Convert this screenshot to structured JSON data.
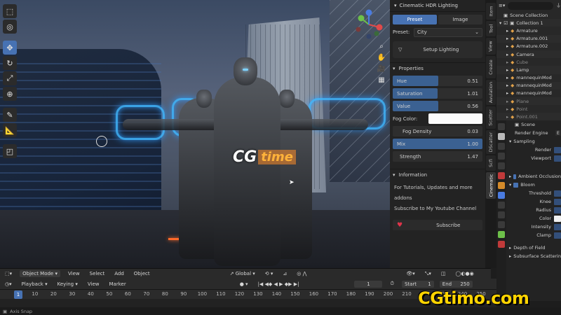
{
  "viewport": {
    "header": {
      "mode": "Object Mode",
      "menus": [
        "View",
        "Select",
        "Add",
        "Object"
      ],
      "transform_orientation": "Global"
    }
  },
  "overlay_watermark": {
    "part1": "CG",
    "part2": "time"
  },
  "corner_watermark": "CGtimo.com",
  "gizmo": {
    "x": "X",
    "y": "Y",
    "z": "Z"
  },
  "npanel": {
    "title": "Cinematic HDR Lighting",
    "tabs": [
      "Preset",
      "Image"
    ],
    "preset_label": "Preset:",
    "preset_value": "City",
    "setup_button": "Setup Lighting",
    "properties_title": "Properties",
    "sliders": [
      {
        "label": "Hue",
        "value": "0.51",
        "fill": 0.51
      },
      {
        "label": "Saturation",
        "value": "1.01",
        "fill": 0.5
      },
      {
        "label": "Value",
        "value": "0.56",
        "fill": 0.56
      }
    ],
    "fog_color_label": "Fog Color:",
    "fog_density": {
      "label": "Fog Density",
      "value": "0.03"
    },
    "mix": {
      "label": "Mix",
      "value": "1.00",
      "fill": 1.0
    },
    "strength": {
      "label": "Strength",
      "value": "1.47"
    },
    "information_title": "Information",
    "info_lines": [
      "For Tutorials, Updates and more addons",
      "Subscribe to My Youtube Channel"
    ],
    "subscribe_button": "Subscribe",
    "colors": {
      "accent": "#4772b3",
      "slider_fill": "#3b6192",
      "fog": "#fbfbfb",
      "heart": "#e0344a"
    }
  },
  "vertical_tabs": [
    "Item",
    "Tool",
    "View",
    "Create",
    "Avulation",
    "Scatter",
    "DScatter",
    "Scfi",
    "Cinematic"
  ],
  "outliner": {
    "root": "Scene Collection",
    "collection": "Collection 1",
    "items": [
      {
        "name": "Armature",
        "dim": false
      },
      {
        "name": "Armature.001",
        "dim": false
      },
      {
        "name": "Armature.002",
        "dim": false
      },
      {
        "name": "Camera",
        "dim": false
      },
      {
        "name": "Cube",
        "dim": true
      },
      {
        "name": "Lamp",
        "dim": false
      },
      {
        "name": "mannequinMod",
        "dim": false
      },
      {
        "name": "mannequinMod",
        "dim": false
      },
      {
        "name": "mannequinMod",
        "dim": false
      },
      {
        "name": "Plane",
        "dim": true
      },
      {
        "name": "Point",
        "dim": true
      },
      {
        "name": "Point.001",
        "dim": true
      }
    ]
  },
  "properties": {
    "scene": "Scene",
    "render_engine_label": "Render Engine",
    "render_engine_value": "E",
    "sampling": "Sampling",
    "render": "Render",
    "viewport": "Viewport",
    "ambient_occlusion": "Ambient Occlusion",
    "bloom": "Bloom",
    "bloom_fields": [
      "Threshold",
      "Knee",
      "Radius",
      "Color",
      "Intensity",
      "Clamp"
    ],
    "depth_of_field": "Depth of Field",
    "sss": "Subsurface Scattering"
  },
  "timeline": {
    "menus": [
      "Playback",
      "Keying",
      "View",
      "Marker"
    ],
    "current_frame": "1",
    "start_label": "Start",
    "start": "1",
    "end_label": "End",
    "end": "250",
    "ticks": [
      1,
      10,
      20,
      30,
      40,
      50,
      60,
      70,
      80,
      90,
      100,
      110,
      120,
      130,
      140,
      150,
      160,
      170,
      180,
      190,
      200,
      210,
      220,
      230,
      240,
      250
    ]
  },
  "status": {
    "text": "Axis Snap"
  }
}
